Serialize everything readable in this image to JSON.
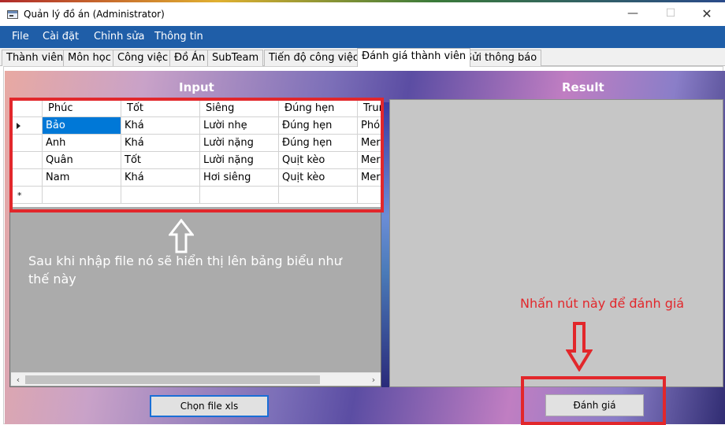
{
  "window": {
    "title": "Quản lý đồ án (Administrator)",
    "min_glyph": "—",
    "max_glyph": "☐",
    "close_glyph": "✕"
  },
  "menu": [
    "File",
    "Cài đặt",
    "Chỉnh sửa",
    "Thông tin"
  ],
  "tabs": [
    "Thành viên",
    "Môn học",
    "Công việc",
    "Đồ Án",
    "SubTeam",
    "Tiến độ công việc",
    "Đánh giá thành viên",
    "Gửi thông báo"
  ],
  "active_tab": "Đánh giá thành viên",
  "input_panel": {
    "title": "Input"
  },
  "result_panel": {
    "title": "Result"
  },
  "grid": {
    "columns": [
      "Phúc",
      "Tốt",
      "Siêng",
      "Đúng hẹn",
      "Trung"
    ],
    "rows": [
      [
        "Bảo",
        "Khá",
        "Lười nhẹ",
        "Đúng hẹn",
        "Phó"
      ],
      [
        "Anh",
        "Khá",
        "Lười nặng",
        "Đúng hẹn",
        "Mer"
      ],
      [
        "Quân",
        "Tốt",
        "Lười nặng",
        "Quịt kèo",
        "Mer"
      ],
      [
        "Nam",
        "Khá",
        "Hơi siêng",
        "Quịt kèo",
        "Mer"
      ]
    ],
    "new_row_marker": "*",
    "scroll_left": "‹",
    "scroll_right": "›"
  },
  "buttons": {
    "choose_file": "Chọn file xls",
    "evaluate": "Đánh giá"
  },
  "annotations": {
    "left_note": "Sau khi nhập file nó sẽ hiển thị lên bảng biểu như thế này",
    "right_note": "Nhấn nút này để đánh giá",
    "up_arrow": "⇧",
    "down_arrow": "⇩"
  },
  "colors": {
    "menubar": "#1f5ea8",
    "annotation_red": "#e2272b",
    "selected_cell": "#0078d7"
  }
}
